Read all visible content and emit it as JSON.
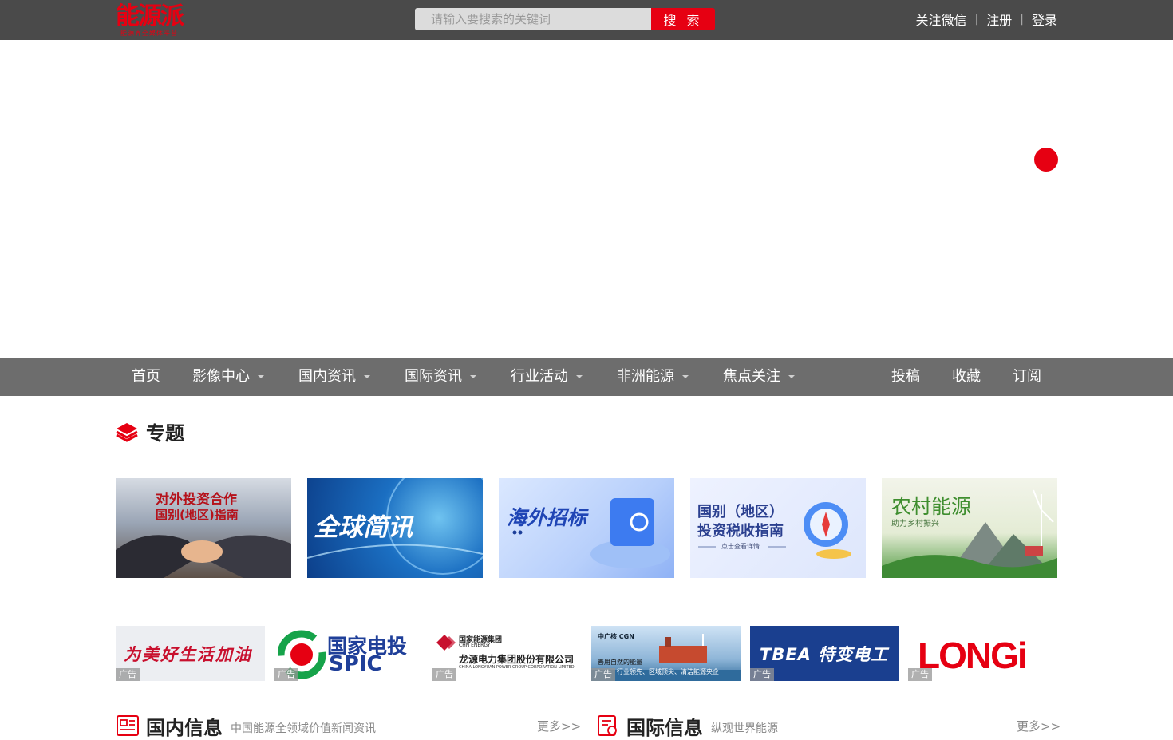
{
  "header": {
    "logo_text": "能源派",
    "logo_sub": "能源界全媒体平台",
    "search_placeholder": "请输入要搜索的关键词",
    "search_button": "搜 索",
    "links": [
      "关注微信",
      "注册",
      "登录"
    ]
  },
  "nav": {
    "items": [
      {
        "label": "首页",
        "dropdown": false
      },
      {
        "label": "影像中心",
        "dropdown": true
      },
      {
        "label": "国内资讯",
        "dropdown": true
      },
      {
        "label": "国际资讯",
        "dropdown": true
      },
      {
        "label": "行业活动",
        "dropdown": true
      },
      {
        "label": "非洲能源",
        "dropdown": true
      },
      {
        "label": "焦点关注",
        "dropdown": true
      }
    ],
    "right_items": [
      "投稿",
      "收藏",
      "订阅"
    ]
  },
  "topics": {
    "title": "专题",
    "cards": [
      {
        "line1": "对外投资合作",
        "line2": "国别(地区)指南"
      },
      {
        "line1": "全球简讯",
        "line2": ""
      },
      {
        "line1": "海外招标",
        "line2": ""
      },
      {
        "line1": "国别（地区）",
        "line2": "投资税收指南",
        "line3": "点击查看详情"
      },
      {
        "line1": "农村能源",
        "line2": "助力乡村振兴"
      }
    ]
  },
  "ads": {
    "tag": "广告",
    "items": [
      {
        "text": "为美好生活加油"
      },
      {
        "text": "国家电投",
        "sub": "SPIC"
      },
      {
        "text": "龙源电力集团股份有限公司",
        "top": "国家能源集团",
        "top_en": "CHN ENERGY",
        "en": "CHINA LONGYUAN POWER GROUP CORPORATION LIMITED"
      },
      {
        "text": "中广核 CGN",
        "line1": "善用自然的能量",
        "line2": "行业领先、区域顶尖、清洁能源央企"
      },
      {
        "text": "TBEA 特变电工"
      },
      {
        "text": "LONGi"
      }
    ]
  },
  "sections": {
    "domestic": {
      "title": "国内信息",
      "subtitle": "中国能源全领域价值新闻资讯",
      "more": "更多>>"
    },
    "international": {
      "title": "国际信息",
      "subtitle": "纵观世界能源",
      "more": "更多>>"
    }
  },
  "colors": {
    "brand_red": "#e60012",
    "topbar": "#4a4a4a",
    "nav": "#6d6d6d"
  }
}
